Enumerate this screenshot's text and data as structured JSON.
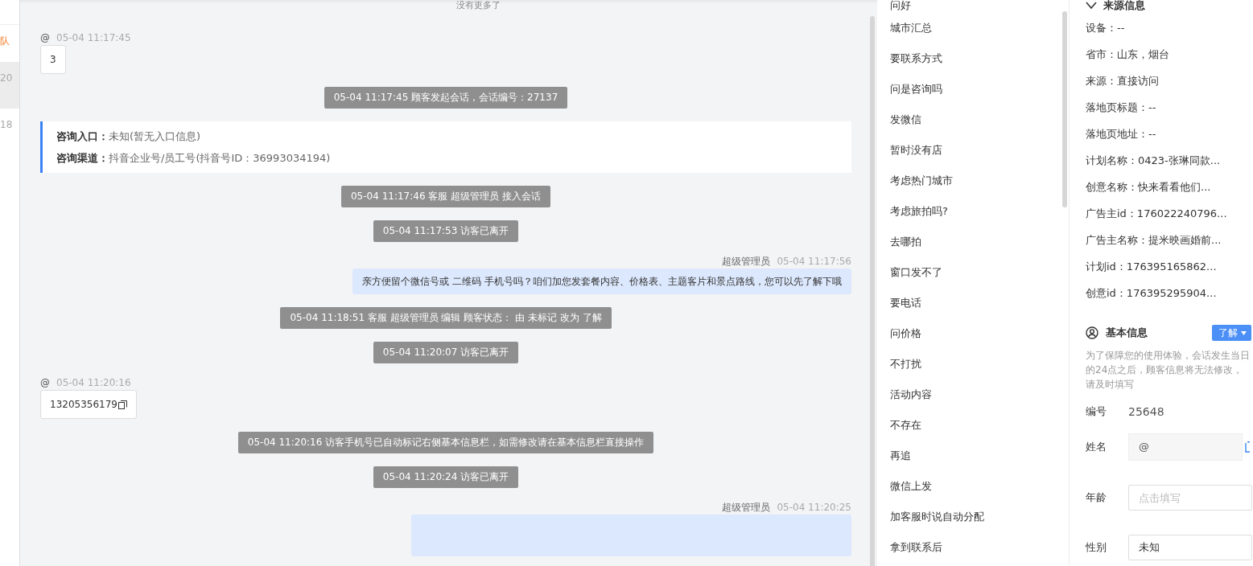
{
  "left_strip": {
    "items": [
      {
        "text": "队",
        "kind": "alert",
        "selected": false
      },
      {
        "text": "20",
        "kind": "time",
        "selected": true
      },
      {
        "text": "18",
        "kind": "time",
        "selected": false
      }
    ]
  },
  "chat": {
    "top_note": "没有更多了",
    "messages": [
      {
        "kind": "visitor",
        "sender": "@",
        "time": "05-04 11:17:45",
        "text": "3",
        "copy": false
      },
      {
        "kind": "system",
        "text": "05-04 11:17:45 顾客发起会话，会话编号：27137"
      },
      {
        "kind": "info",
        "rows": [
          {
            "label": "咨询入口：",
            "value": "未知(暂无入口信息)"
          },
          {
            "label": "咨询渠道：",
            "value": "抖音企业号/员工号(抖音号ID：36993034194)"
          }
        ]
      },
      {
        "kind": "system",
        "text": "05-04 11:17:46 客服 超级管理员 接入会话"
      },
      {
        "kind": "system",
        "text": "05-04 11:17:53 访客已离开"
      },
      {
        "kind": "agent",
        "sender": "超级管理员",
        "time": "05-04 11:17:56",
        "text": "亲方便留个微信号或 二维码 手机号吗？咱们加您发套餐内容、价格表、主题客片和景点路线，您可以先了解下哦"
      },
      {
        "kind": "system",
        "text": "05-04 11:18:51 客服 超级管理员 编辑 顾客状态： 由 未标记 改为 了解"
      },
      {
        "kind": "system",
        "text": "05-04 11:20:07 访客已离开"
      },
      {
        "kind": "visitor",
        "sender": "@",
        "time": "05-04 11:20:16",
        "text": "13205356179",
        "copy": true
      },
      {
        "kind": "system",
        "text": "05-04 11:20:16 访客手机号已自动标记右侧基本信息栏，如需修改请在基本信息栏直接操作"
      },
      {
        "kind": "system",
        "text": "05-04 11:20:24 访客已离开"
      },
      {
        "kind": "agent",
        "sender": "超级管理员",
        "time": "05-04 11:20:25"
      }
    ]
  },
  "quick_phrases": [
    "问好",
    "城市汇总",
    "要联系方式",
    "问是咨询吗",
    "发微信",
    "暂时没有店",
    "考虑热门城市",
    "考虑旅拍吗?",
    "去哪拍",
    "窗口发不了",
    "要电话",
    "问价格",
    "不打扰",
    "活动内容",
    "不存在",
    "再追",
    "微信上发",
    "加客服时说自动分配",
    "拿到联系后"
  ],
  "source_info": {
    "title": "来源信息",
    "lines": [
      "设备：--",
      "省市：山东，烟台",
      "来源：直接访问",
      "落地页标题：--",
      "落地页地址：--",
      "计划名称：0423-张琳同款...",
      "创意名称：快来看看他们...",
      "广告主id：176022240796...",
      "广告主名称：提米映画婚前...",
      "计划id：176395165862...",
      "创意id：176395295904..."
    ]
  },
  "basic_info": {
    "title": "基本信息",
    "status": "了解",
    "note": "为了保障您的使用体验，会话发生当日的24点之后，顾客信息将无法修改，请及时填写",
    "fields": [
      {
        "kind": "text",
        "label": "编号",
        "value": "25648"
      },
      {
        "kind": "readonly",
        "label": "姓名",
        "value": "@"
      },
      {
        "kind": "input",
        "label": "年龄",
        "placeholder": "点击填写"
      },
      {
        "kind": "input",
        "label": "性别",
        "value": "未知"
      }
    ]
  }
}
